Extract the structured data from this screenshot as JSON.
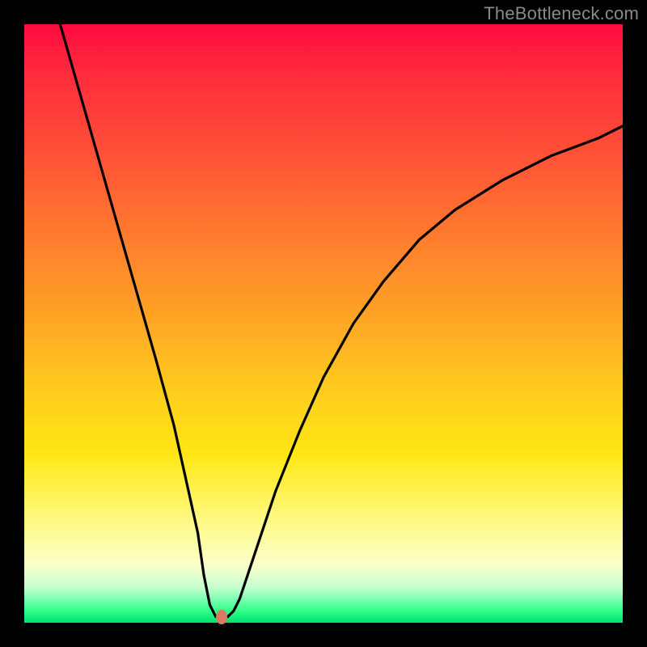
{
  "watermark": "TheBottleneck.com",
  "chart_data": {
    "type": "line",
    "title": "",
    "xlabel": "",
    "ylabel": "",
    "xlim": [
      0,
      100
    ],
    "ylim": [
      0,
      100
    ],
    "grid": false,
    "legend": false,
    "series": [
      {
        "name": "curve",
        "x": [
          6,
          10,
          14,
          18,
          22,
          25,
          27,
          29,
          30,
          31,
          32,
          33,
          34,
          35,
          36,
          38,
          40,
          42,
          46,
          50,
          55,
          60,
          66,
          72,
          80,
          88,
          96,
          100
        ],
        "y": [
          100,
          86,
          72,
          58,
          44,
          33,
          24,
          15,
          8,
          3,
          1,
          1,
          1,
          2,
          4,
          10,
          16,
          22,
          32,
          41,
          50,
          57,
          64,
          69,
          74,
          78,
          81,
          83
        ]
      }
    ],
    "marker": {
      "x": 33,
      "y": 1,
      "color": "#d97b63"
    },
    "gradient_stops": [
      {
        "pos": 0.0,
        "color": "#ff0a3f"
      },
      {
        "pos": 0.08,
        "color": "#ff2a3d"
      },
      {
        "pos": 0.22,
        "color": "#ff5236"
      },
      {
        "pos": 0.35,
        "color": "#ff7a2e"
      },
      {
        "pos": 0.48,
        "color": "#ffa126"
      },
      {
        "pos": 0.6,
        "color": "#ffc81e"
      },
      {
        "pos": 0.72,
        "color": "#ffe714"
      },
      {
        "pos": 0.82,
        "color": "#fff87a"
      },
      {
        "pos": 0.9,
        "color": "#fbffc8"
      },
      {
        "pos": 0.94,
        "color": "#c8ffd0"
      },
      {
        "pos": 0.96,
        "color": "#7fffb0"
      },
      {
        "pos": 0.98,
        "color": "#30ff8a"
      },
      {
        "pos": 1.0,
        "color": "#00e070"
      }
    ]
  }
}
